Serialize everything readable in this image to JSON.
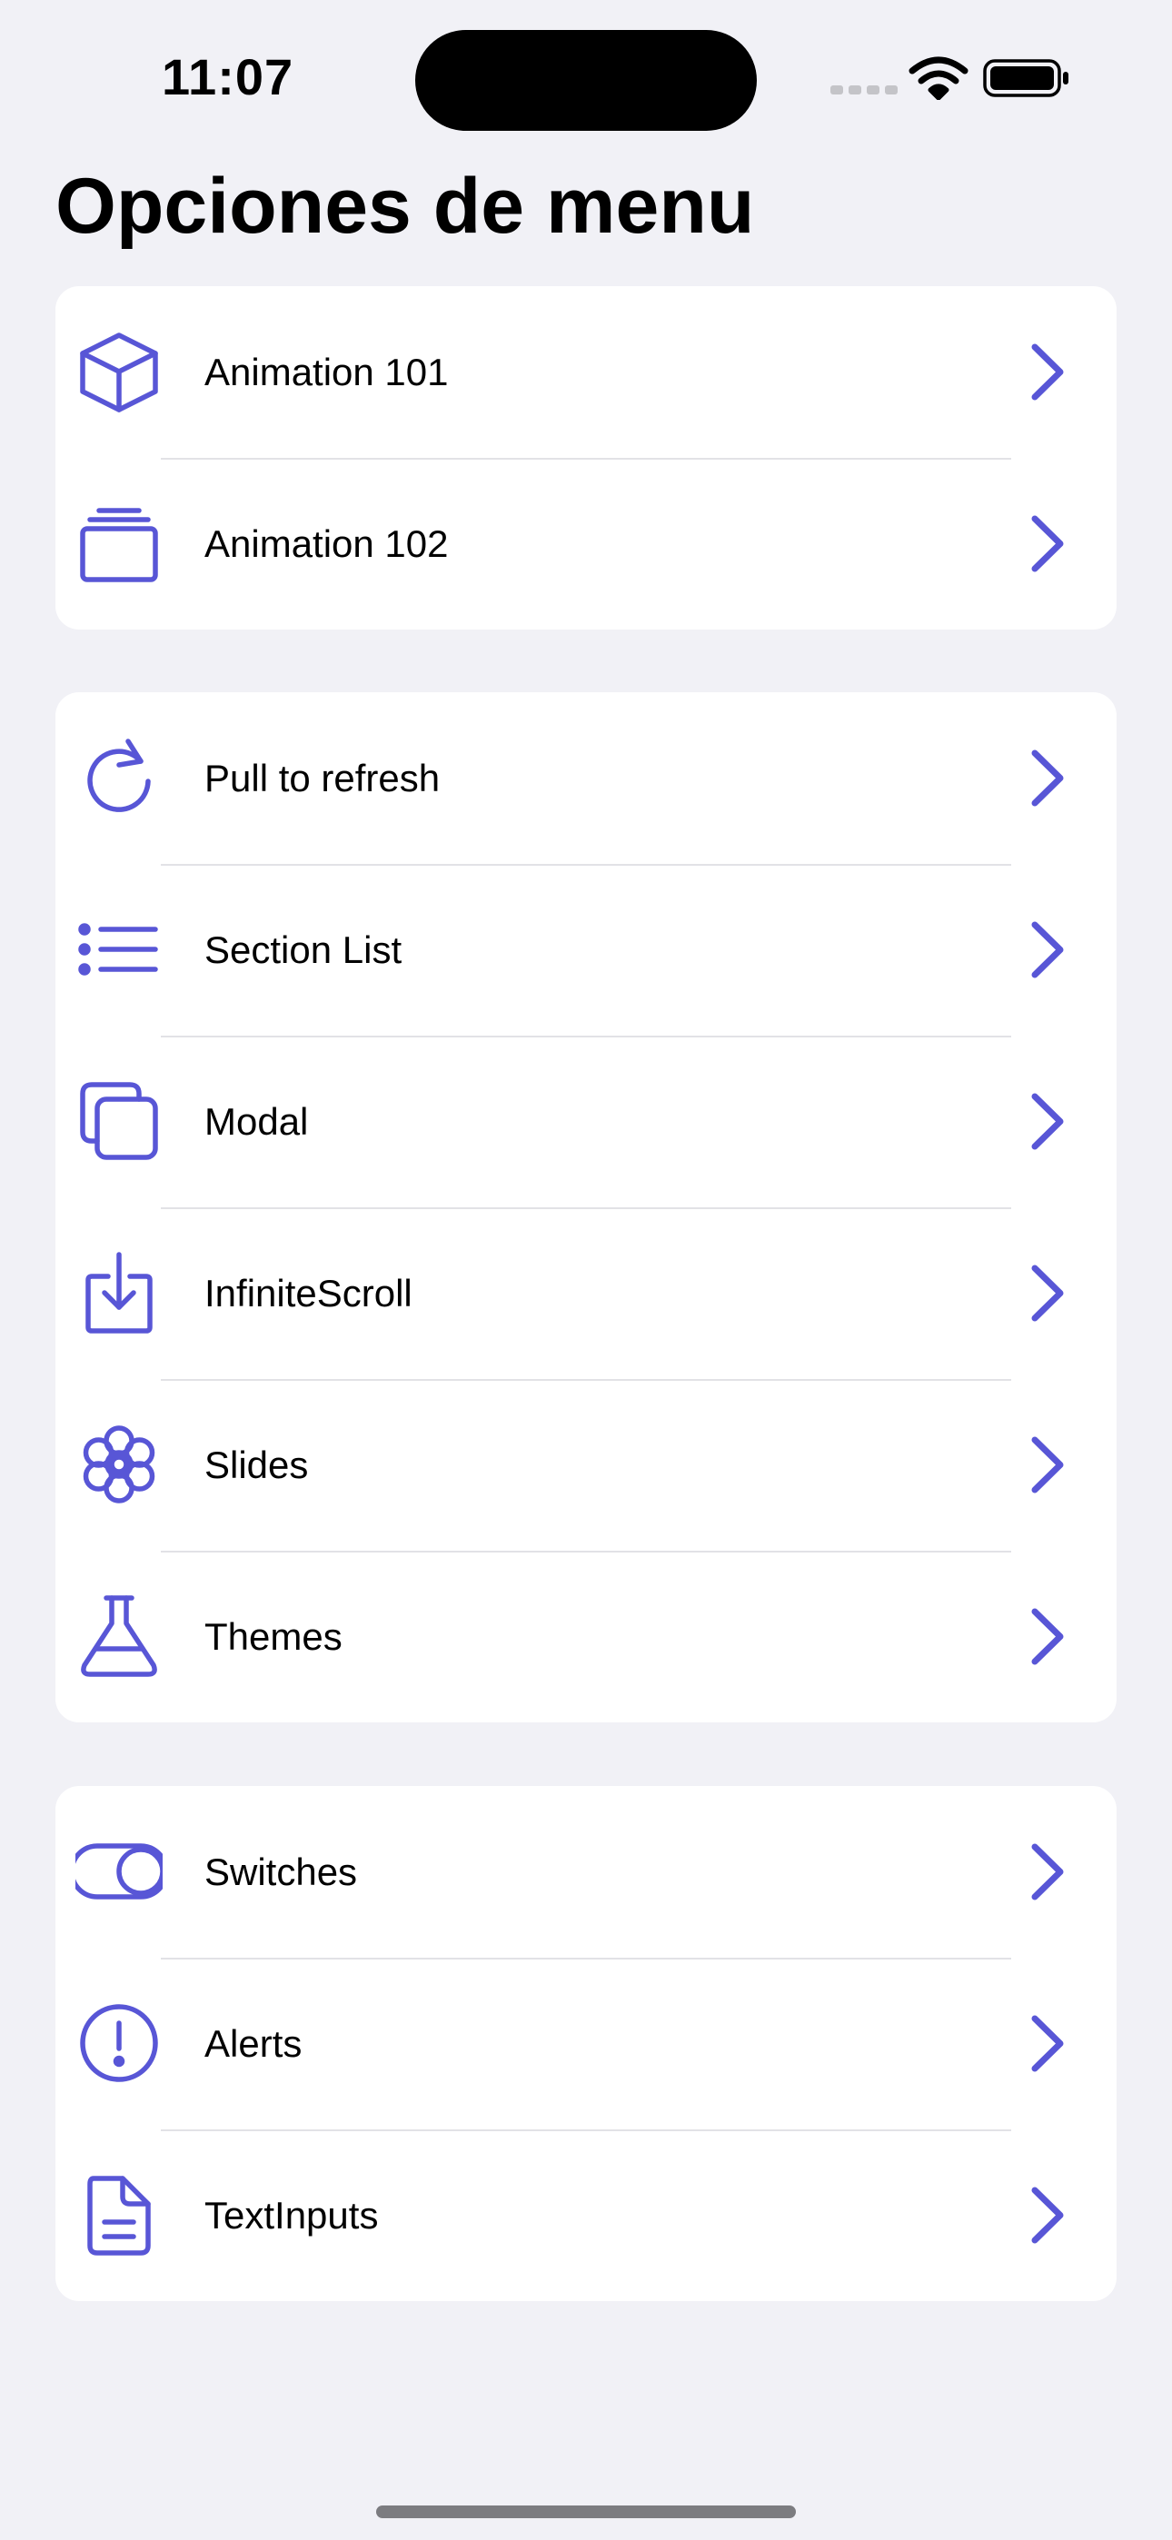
{
  "status_bar": {
    "time": "11:07"
  },
  "page_title": "Opciones de menu",
  "accent_color": "#5856d6",
  "groups": [
    {
      "items": [
        {
          "label": "Animation 101",
          "icon": "cube-icon"
        },
        {
          "label": "Animation 102",
          "icon": "albums-icon"
        }
      ]
    },
    {
      "items": [
        {
          "label": "Pull to refresh",
          "icon": "refresh-icon"
        },
        {
          "label": "Section List",
          "icon": "list-icon"
        },
        {
          "label": "Modal",
          "icon": "copy-icon"
        },
        {
          "label": "InfiniteScroll",
          "icon": "download-icon"
        },
        {
          "label": "Slides",
          "icon": "flower-icon"
        },
        {
          "label": "Themes",
          "icon": "flask-icon"
        }
      ]
    },
    {
      "items": [
        {
          "label": "Switches",
          "icon": "toggle-icon"
        },
        {
          "label": "Alerts",
          "icon": "alert-circle-icon"
        },
        {
          "label": "TextInputs",
          "icon": "document-text-icon"
        }
      ]
    }
  ]
}
